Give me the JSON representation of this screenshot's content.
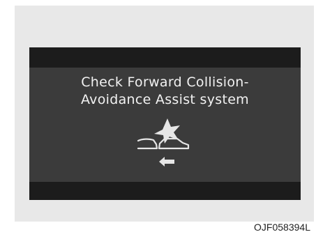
{
  "display": {
    "message_line1": "Check Forward Collision-",
    "message_line2": "Avoidance Assist system",
    "icon": "forward-collision-assist-warning-icon"
  },
  "figure_code": "OJF058394L",
  "colors": {
    "screen_background": "#3b3b3b",
    "screen_bars": "#1c1c1c",
    "text": "#f2f2f2",
    "frame_background": "#e8e8e8"
  }
}
